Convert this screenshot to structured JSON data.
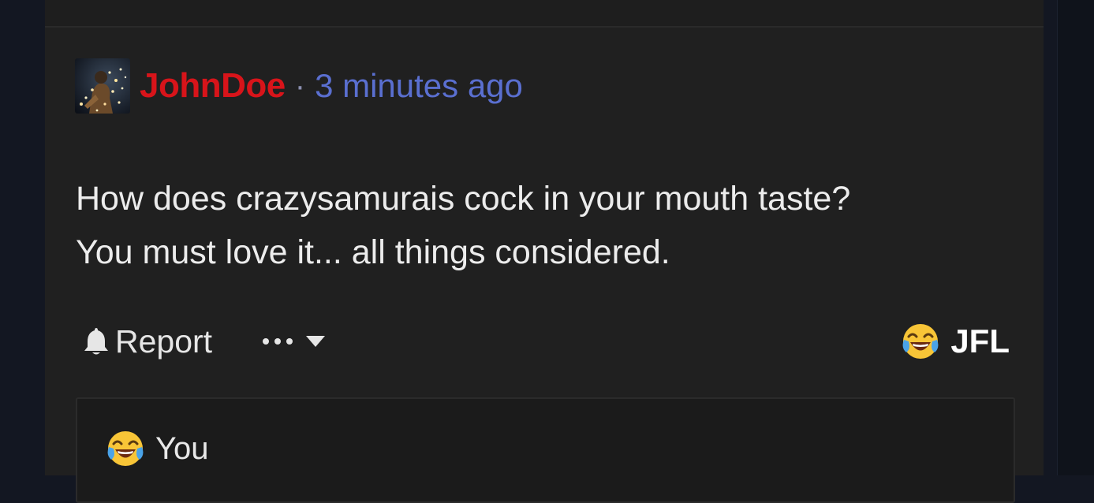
{
  "post": {
    "author": "JohnDoe",
    "separator": "·",
    "time": "3 minutes ago",
    "avatar_icon": "user-avatar-photo",
    "message_lines": [
      "How does crazysamurais cock in your mouth taste?",
      "You must love it... all things considered."
    ]
  },
  "actions": {
    "report_label": "Report",
    "report_icon": "bell-icon",
    "more_icon": "ellipsis-icon",
    "dropdown_icon": "caret-down-icon"
  },
  "reaction": {
    "label": "JFL",
    "icon": "laughing-crying-emoji-icon"
  },
  "reactions_list": [
    {
      "name": "You",
      "icon": "laughing-crying-emoji-icon"
    }
  ],
  "colors": {
    "page_bg": "#131722",
    "card_bg": "#202020",
    "username": "#d8141a",
    "timestamp": "#5a6fd0",
    "text": "#ececec"
  }
}
